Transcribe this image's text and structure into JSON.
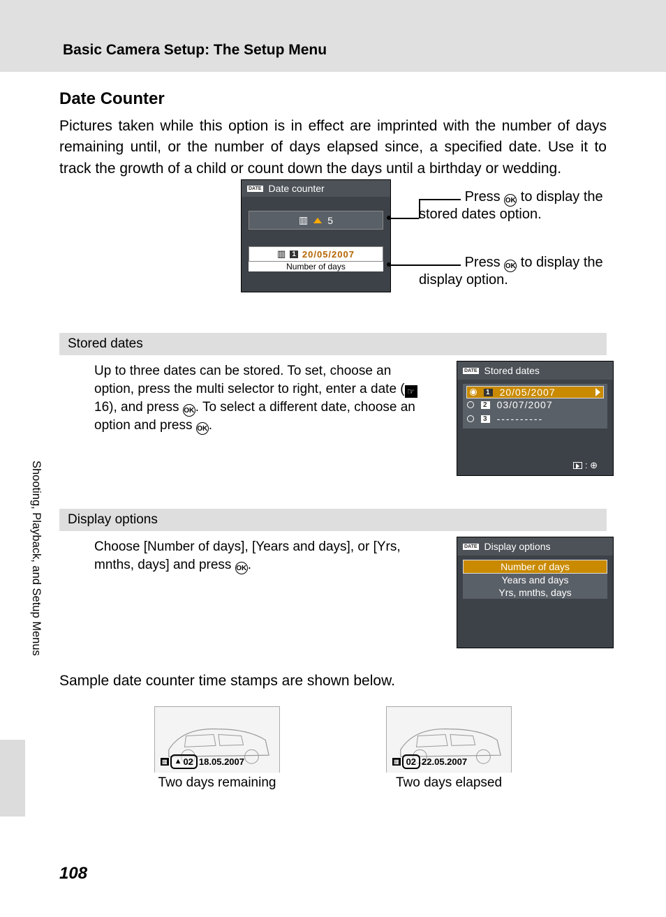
{
  "header": {
    "chapter_title": "Basic Camera Setup: The Setup Menu"
  },
  "section": {
    "title": "Date Counter",
    "body": "Pictures taken while this option is in effect are imprinted with the number of days remaining until, or the number of days elapsed since, a specified date. Use it to track the growth of a child or count down the days until a birthday or wedding."
  },
  "main_lcd": {
    "title": "Date counter",
    "row1_value": "5",
    "row2_date": "20/05/2007",
    "row2_label": "Number of days"
  },
  "callouts": {
    "c1a": "Press ",
    "c1b": " to display the stored dates option.",
    "c2a": "Press ",
    "c2b": " to display the display option."
  },
  "stored": {
    "header": "Stored dates",
    "text_a": "Up to three dates can be stored. To set, choose an option, press the multi selector to right, enter a date (",
    "text_ref": " 16), and press ",
    "text_b": ". To select a different date, choose an option and press ",
    "lcd_title": "Stored dates",
    "dates": [
      "20/05/2007",
      "03/07/2007",
      "----------"
    ]
  },
  "display_opts": {
    "header": "Display options",
    "text_a": "Choose [Number of days], [Years and days], or [Yrs, mnths, days] and press ",
    "lcd_title": "Display options",
    "options": [
      "Number of days",
      "Years and days",
      "Yrs, mnths, days"
    ]
  },
  "samples": {
    "intro": "Sample date counter time stamps are shown below.",
    "left": {
      "stamp_num": "02",
      "stamp_date": "18.05.2007",
      "caption": "Two days remaining",
      "arrow": "▲"
    },
    "right": {
      "stamp_num": "02",
      "stamp_date": "22.05.2007",
      "caption": "Two days elapsed"
    }
  },
  "side_label": "Shooting, Playback, and Setup Menus",
  "page_number": "108",
  "glyphs": {
    "ok": "OK",
    "date_badge": "DATE",
    "num_1": "1",
    "num_2": "2",
    "num_3": "3"
  }
}
